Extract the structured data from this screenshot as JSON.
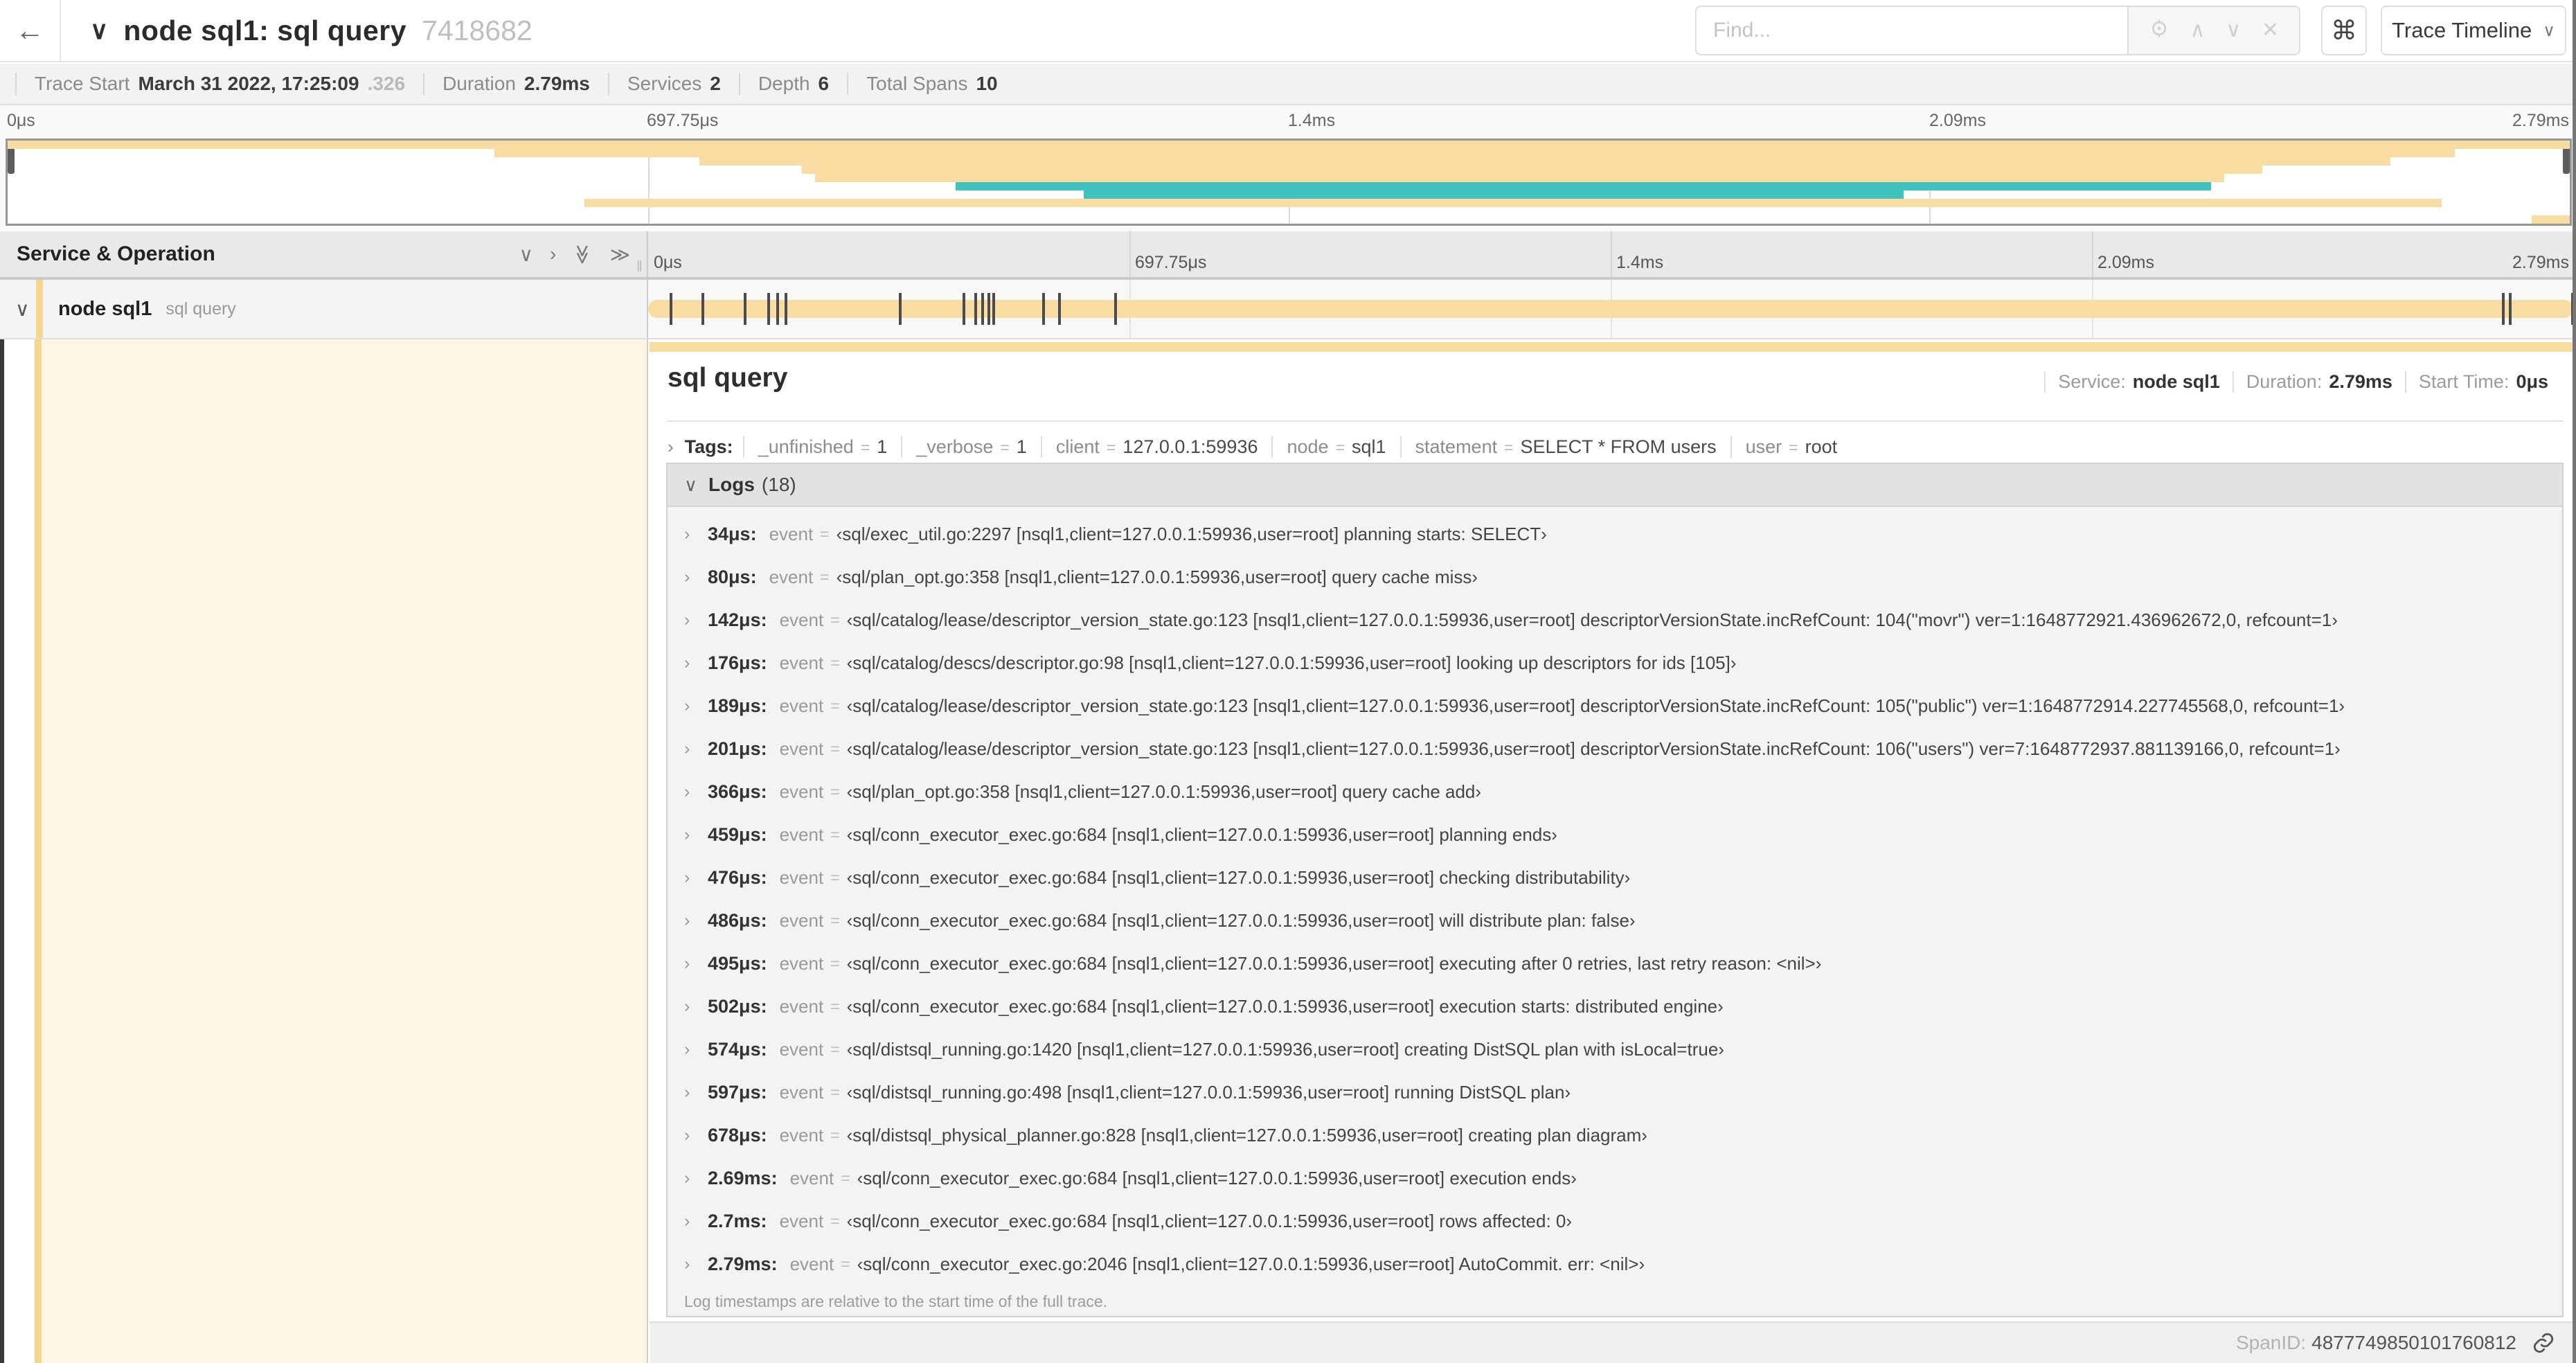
{
  "header": {
    "back_icon": "←",
    "collapse_icon": "∨",
    "title": "node sql1: sql query",
    "trace_id": "7418682",
    "search": {
      "placeholder": "Find..."
    },
    "shortcut_button": "⌘",
    "view_dropdown": {
      "label": "Trace Timeline",
      "caret": "∨"
    }
  },
  "summary": {
    "items": [
      {
        "label": "Trace Start",
        "value": "March 31 2022, 17:25:09",
        "suffix": ".326"
      },
      {
        "label": "Duration",
        "value": "2.79ms"
      },
      {
        "label": "Services",
        "value": "2"
      },
      {
        "label": "Depth",
        "value": "6"
      },
      {
        "label": "Total Spans",
        "value": "10"
      }
    ]
  },
  "colors": {
    "span_tan": "#f8dca1",
    "span_teal": "#3fc3bf",
    "detail_bg": "#fdf5e6",
    "stripe": "#f5d68f"
  },
  "minimap": {
    "axis_ticks": [
      "0μs",
      "697.75μs",
      "1.4ms",
      "2.09ms",
      "2.79ms"
    ],
    "spans": [
      {
        "row": 0,
        "start": 0,
        "end": 100,
        "color": "tan"
      },
      {
        "row": 1,
        "start": 19,
        "end": 95.5,
        "color": "tan"
      },
      {
        "row": 2,
        "start": 27,
        "end": 93,
        "color": "tan"
      },
      {
        "row": 3,
        "start": 31,
        "end": 88,
        "color": "tan"
      },
      {
        "row": 4,
        "start": 31.5,
        "end": 86.5,
        "color": "tan"
      },
      {
        "row": 5,
        "start": 37,
        "end": 86,
        "color": "teal"
      },
      {
        "row": 6,
        "start": 42,
        "end": 74,
        "color": "teal"
      },
      {
        "row": 7,
        "start": 22.5,
        "end": 95,
        "color": "tan"
      },
      {
        "row": 9,
        "start": 98.5,
        "end": 100,
        "color": "tan"
      }
    ]
  },
  "timeline": {
    "left_header": "Service & Operation",
    "axis_ticks": [
      "0μs",
      "697.75μs",
      "1.4ms",
      "2.09ms",
      "2.79ms"
    ],
    "row": {
      "service": "node sql1",
      "operation": "sql query"
    },
    "duration_us": 2790,
    "log_marker_times_us": [
      34,
      80,
      142,
      176,
      189,
      201,
      366,
      459,
      476,
      486,
      495,
      502,
      574,
      597,
      678,
      2690,
      2700,
      2790
    ]
  },
  "detail": {
    "title": "sql query",
    "eq_sign": "=",
    "meta": [
      {
        "label": "Service:",
        "value": "node sql1"
      },
      {
        "label": "Duration:",
        "value": "2.79ms"
      },
      {
        "label": "Start Time:",
        "value": "0μs"
      }
    ],
    "tags_label": "Tags:",
    "tags": [
      {
        "key": "_unfinished",
        "value": "1"
      },
      {
        "key": "_verbose",
        "value": "1"
      },
      {
        "key": "client",
        "value": "127.0.0.1:59936"
      },
      {
        "key": "node",
        "value": "sql1"
      },
      {
        "key": "statement",
        "value": "SELECT * FROM users"
      },
      {
        "key": "user",
        "value": "root"
      }
    ],
    "logs_label": "Logs",
    "logs_count": "(18)",
    "logs": [
      {
        "time": "34μs:",
        "field": "event",
        "value": "‹sql/exec_util.go:2297 [nsql1,client=127.0.0.1:59936,user=root] planning starts: SELECT›"
      },
      {
        "time": "80μs:",
        "field": "event",
        "value": "‹sql/plan_opt.go:358 [nsql1,client=127.0.0.1:59936,user=root] query cache miss›"
      },
      {
        "time": "142μs:",
        "field": "event",
        "value": "‹sql/catalog/lease/descriptor_version_state.go:123 [nsql1,client=127.0.0.1:59936,user=root] descriptorVersionState.incRefCount: 104(\"movr\") ver=1:1648772921.436962672,0, refcount=1›"
      },
      {
        "time": "176μs:",
        "field": "event",
        "value": "‹sql/catalog/descs/descriptor.go:98 [nsql1,client=127.0.0.1:59936,user=root] looking up descriptors for ids [105]›"
      },
      {
        "time": "189μs:",
        "field": "event",
        "value": "‹sql/catalog/lease/descriptor_version_state.go:123 [nsql1,client=127.0.0.1:59936,user=root] descriptorVersionState.incRefCount: 105(\"public\") ver=1:1648772914.227745568,0, refcount=1›"
      },
      {
        "time": "201μs:",
        "field": "event",
        "value": "‹sql/catalog/lease/descriptor_version_state.go:123 [nsql1,client=127.0.0.1:59936,user=root] descriptorVersionState.incRefCount: 106(\"users\") ver=7:1648772937.881139166,0, refcount=1›"
      },
      {
        "time": "366μs:",
        "field": "event",
        "value": "‹sql/plan_opt.go:358 [nsql1,client=127.0.0.1:59936,user=root] query cache add›"
      },
      {
        "time": "459μs:",
        "field": "event",
        "value": "‹sql/conn_executor_exec.go:684 [nsql1,client=127.0.0.1:59936,user=root] planning ends›"
      },
      {
        "time": "476μs:",
        "field": "event",
        "value": "‹sql/conn_executor_exec.go:684 [nsql1,client=127.0.0.1:59936,user=root] checking distributability›"
      },
      {
        "time": "486μs:",
        "field": "event",
        "value": "‹sql/conn_executor_exec.go:684 [nsql1,client=127.0.0.1:59936,user=root] will distribute plan: false›"
      },
      {
        "time": "495μs:",
        "field": "event",
        "value": "‹sql/conn_executor_exec.go:684 [nsql1,client=127.0.0.1:59936,user=root] executing after 0 retries, last retry reason: <nil>›"
      },
      {
        "time": "502μs:",
        "field": "event",
        "value": "‹sql/conn_executor_exec.go:684 [nsql1,client=127.0.0.1:59936,user=root] execution starts: distributed engine›"
      },
      {
        "time": "574μs:",
        "field": "event",
        "value": "‹sql/distsql_running.go:1420 [nsql1,client=127.0.0.1:59936,user=root] creating DistSQL plan with isLocal=true›"
      },
      {
        "time": "597μs:",
        "field": "event",
        "value": "‹sql/distsql_running.go:498 [nsql1,client=127.0.0.1:59936,user=root] running DistSQL plan›"
      },
      {
        "time": "678μs:",
        "field": "event",
        "value": "‹sql/distsql_physical_planner.go:828 [nsql1,client=127.0.0.1:59936,user=root] creating plan diagram›"
      },
      {
        "time": "2.69ms:",
        "field": "event",
        "value": "‹sql/conn_executor_exec.go:684 [nsql1,client=127.0.0.1:59936,user=root] execution ends›"
      },
      {
        "time": "2.7ms:",
        "field": "event",
        "value": "‹sql/conn_executor_exec.go:684 [nsql1,client=127.0.0.1:59936,user=root] rows affected: 0›"
      },
      {
        "time": "2.79ms:",
        "field": "event",
        "value": "‹sql/conn_executor_exec.go:2046 [nsql1,client=127.0.0.1:59936,user=root] AutoCommit. err: <nil>›"
      }
    ],
    "logs_note": "Log timestamps are relative to the start time of the full trace.",
    "span_id_label": "SpanID:",
    "span_id": "4877749850101760812"
  }
}
